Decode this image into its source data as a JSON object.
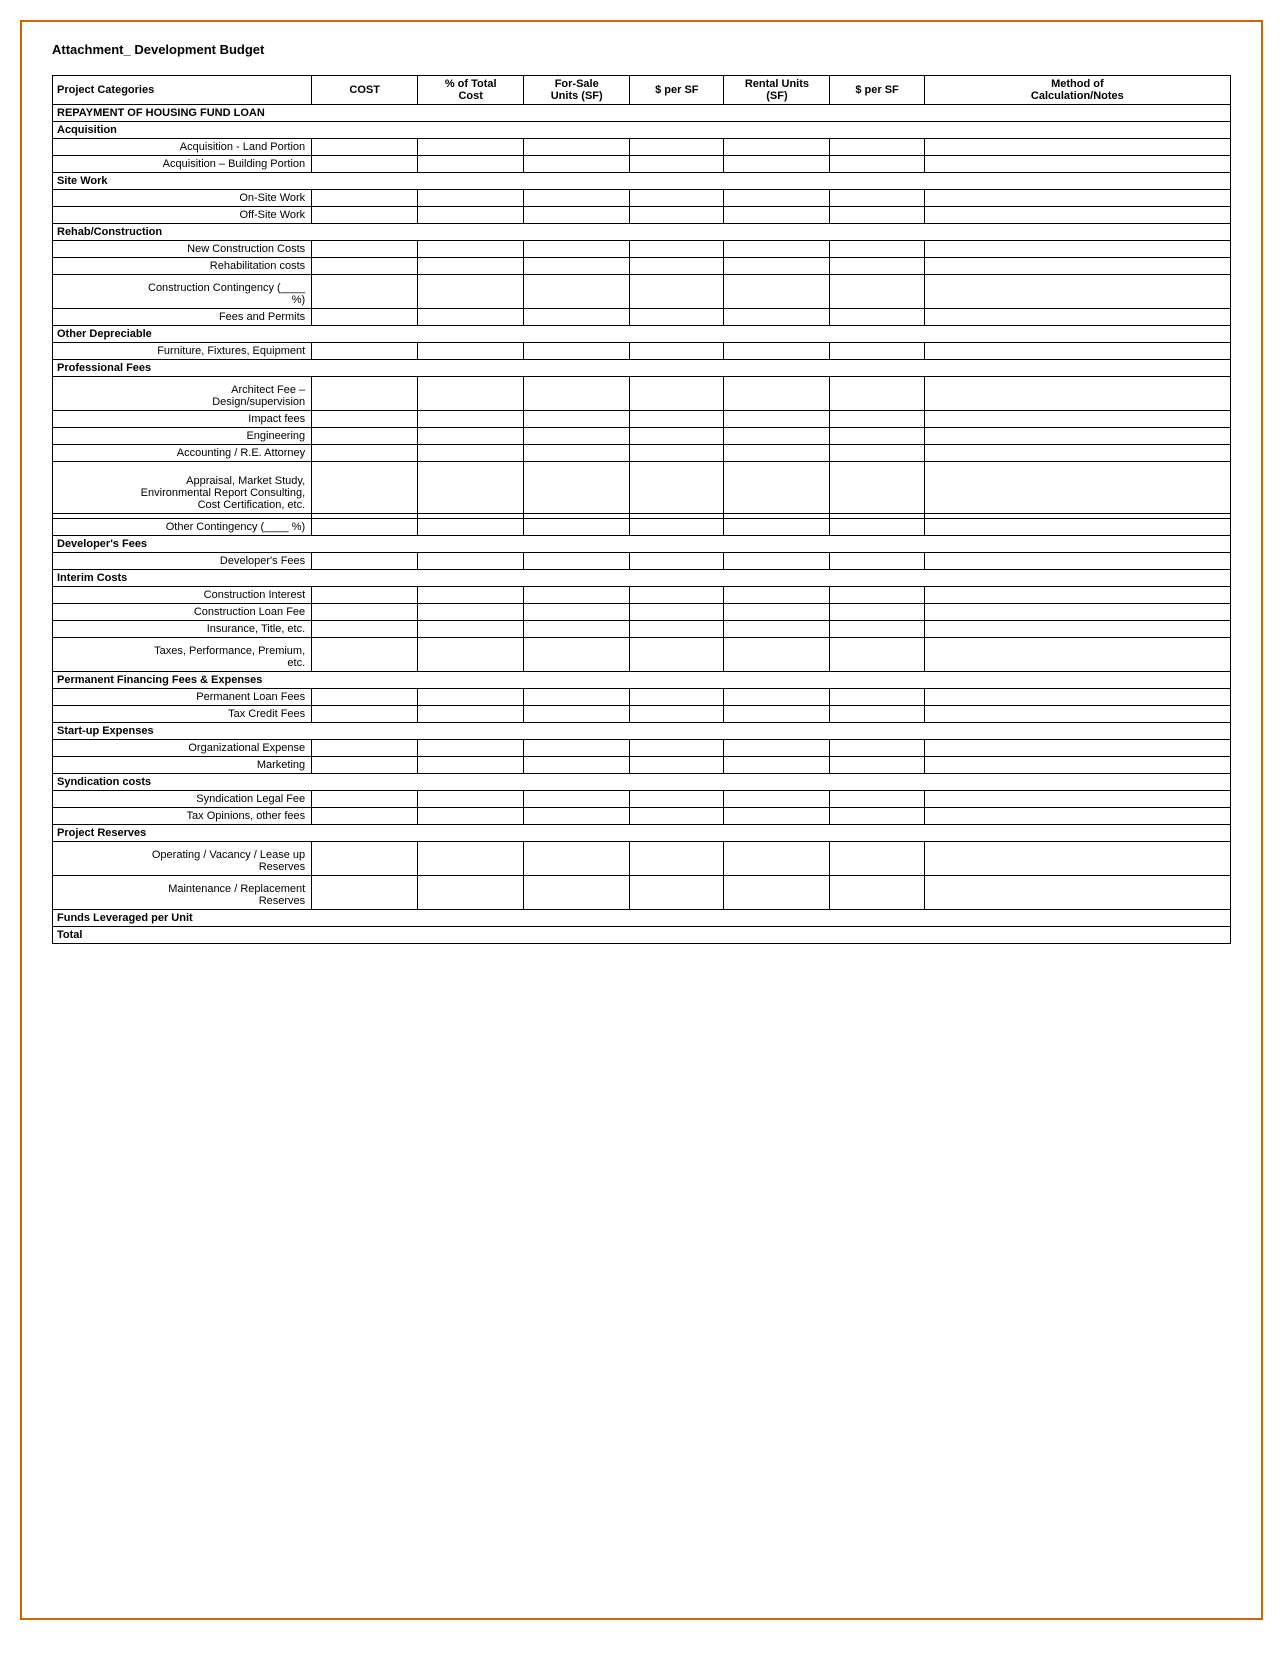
{
  "title": "Attachment_ Development Budget",
  "columns": {
    "categories": "Project Categories",
    "cost": "COST",
    "pct": "% of Total Cost",
    "forsale": "For-Sale Units (SF)",
    "persf1": "$ per SF",
    "rental": "Rental Units (SF)",
    "persf2": "$ per SF",
    "method": "Method of Calculation/Notes"
  },
  "sections": [
    {
      "type": "section-header",
      "label": "REPAYMENT OF HOUSING FUND LOAN",
      "bold": true
    },
    {
      "type": "section-header",
      "label": "Acquisition",
      "bold": true
    },
    {
      "type": "data-row",
      "label": "Acquisition - Land Portion",
      "indent": true
    },
    {
      "type": "data-row",
      "label": "Acquisition – Building Portion",
      "indent": true
    },
    {
      "type": "section-header",
      "label": "Site Work",
      "bold": true
    },
    {
      "type": "data-row",
      "label": "On-Site Work",
      "indent": true
    },
    {
      "type": "data-row",
      "label": "Off-Site Work",
      "indent": true
    },
    {
      "type": "section-header",
      "label": "Rehab/Construction",
      "bold": true
    },
    {
      "type": "data-row",
      "label": "New Construction Costs",
      "indent": true
    },
    {
      "type": "data-row",
      "label": "Rehabilitation costs",
      "indent": true
    },
    {
      "type": "data-row",
      "label": "Construction Contingency (____\n%)",
      "indent": true,
      "tall": true
    },
    {
      "type": "data-row",
      "label": "Fees and Permits",
      "indent": true
    },
    {
      "type": "section-header",
      "label": "Other Depreciable",
      "bold": true
    },
    {
      "type": "data-row",
      "label": "Furniture, Fixtures, Equipment",
      "indent": true
    },
    {
      "type": "section-header",
      "label": "Professional Fees",
      "bold": true
    },
    {
      "type": "data-row",
      "label": "Architect Fee –\nDesign/supervision",
      "indent": true,
      "tall": true
    },
    {
      "type": "data-row",
      "label": "Impact fees",
      "indent": true
    },
    {
      "type": "data-row",
      "label": "Engineering",
      "indent": true
    },
    {
      "type": "data-row",
      "label": "Accounting / R.E. Attorney",
      "indent": true
    },
    {
      "type": "data-row",
      "label": "Appraisal, Market Study,\nEnvironmental Report Consulting,\nCost Certification, etc.",
      "indent": true,
      "three": true
    },
    {
      "type": "data-row",
      "label": "",
      "indent": false
    },
    {
      "type": "data-row",
      "label": "Other Contingency (____ %)",
      "indent": true
    },
    {
      "type": "section-header",
      "label": "Developer's Fees",
      "bold": true
    },
    {
      "type": "data-row",
      "label": "Developer's Fees",
      "indent": true
    },
    {
      "type": "section-header",
      "label": "Interim Costs",
      "bold": true
    },
    {
      "type": "data-row",
      "label": "Construction Interest",
      "indent": true
    },
    {
      "type": "data-row",
      "label": "Construction Loan Fee",
      "indent": true
    },
    {
      "type": "data-row",
      "label": "Insurance, Title, etc.",
      "indent": true
    },
    {
      "type": "data-row",
      "label": "Taxes, Performance, Premium,\netc.",
      "indent": true,
      "tall": true
    },
    {
      "type": "section-header",
      "label": "Permanent Financing Fees & Expenses",
      "bold": true
    },
    {
      "type": "data-row",
      "label": "Permanent Loan Fees",
      "indent": true
    },
    {
      "type": "data-row",
      "label": "Tax Credit Fees",
      "indent": true
    },
    {
      "type": "section-header",
      "label": "Start-up Expenses",
      "bold": true
    },
    {
      "type": "data-row",
      "label": "Organizational Expense",
      "indent": true
    },
    {
      "type": "data-row",
      "label": "Marketing",
      "indent": true
    },
    {
      "type": "section-header",
      "label": "Syndication costs",
      "bold": true
    },
    {
      "type": "data-row",
      "label": "Syndication Legal Fee",
      "indent": true
    },
    {
      "type": "data-row",
      "label": "Tax Opinions, other fees",
      "indent": true
    },
    {
      "type": "section-header",
      "label": "Project Reserves",
      "bold": true
    },
    {
      "type": "data-row",
      "label": "Operating / Vacancy /  Lease up\nReserves",
      "indent": true,
      "tall": true
    },
    {
      "type": "data-row",
      "label": "Maintenance / Replacement\nReserves",
      "indent": true,
      "tall": true
    },
    {
      "type": "section-header",
      "label": "Funds Leveraged per Unit",
      "bold": true
    },
    {
      "type": "section-header",
      "label": "Total",
      "bold": true
    }
  ]
}
